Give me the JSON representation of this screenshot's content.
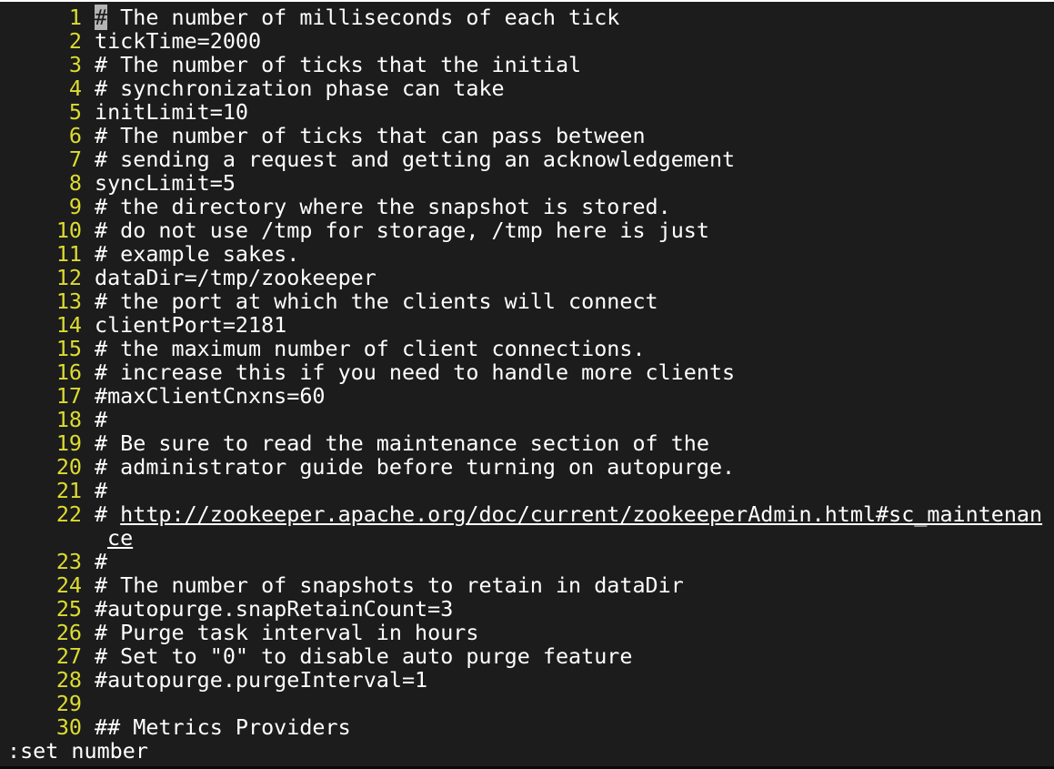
{
  "editor": {
    "lines": [
      {
        "num": "1",
        "text": " The number of milliseconds of each tick"
      },
      {
        "num": "2",
        "text": "tickTime=2000"
      },
      {
        "num": "3",
        "text": "# The number of ticks that the initial"
      },
      {
        "num": "4",
        "text": "# synchronization phase can take"
      },
      {
        "num": "5",
        "text": "initLimit=10"
      },
      {
        "num": "6",
        "text": "# The number of ticks that can pass between"
      },
      {
        "num": "7",
        "text": "# sending a request and getting an acknowledgement"
      },
      {
        "num": "8",
        "text": "syncLimit=5"
      },
      {
        "num": "9",
        "text": "# the directory where the snapshot is stored."
      },
      {
        "num": "10",
        "text": "# do not use /tmp for storage, /tmp here is just"
      },
      {
        "num": "11",
        "text": "# example sakes."
      },
      {
        "num": "12",
        "text": "dataDir=/tmp/zookeeper"
      },
      {
        "num": "13",
        "text": "# the port at which the clients will connect"
      },
      {
        "num": "14",
        "text": "clientPort=2181"
      },
      {
        "num": "15",
        "text": "# the maximum number of client connections."
      },
      {
        "num": "16",
        "text": "# increase this if you need to handle more clients"
      },
      {
        "num": "17",
        "text": "#maxClientCnxns=60"
      },
      {
        "num": "18",
        "text": "#"
      },
      {
        "num": "19",
        "text": "# Be sure to read the maintenance section of the"
      },
      {
        "num": "20",
        "text": "# administrator guide before turning on autopurge."
      },
      {
        "num": "21",
        "text": "#"
      },
      {
        "num": "22",
        "text": "# ",
        "url": "http://zookeeper.apache.org/doc/current/zookeeperAdmin.html#sc_maintenan",
        "url_cont": "ce"
      },
      {
        "num": "23",
        "text": "#"
      },
      {
        "num": "24",
        "text": "# The number of snapshots to retain in dataDir"
      },
      {
        "num": "25",
        "text": "#autopurge.snapRetainCount=3"
      },
      {
        "num": "26",
        "text": "# Purge task interval in hours"
      },
      {
        "num": "27",
        "text": "# Set to \"0\" to disable auto purge feature"
      },
      {
        "num": "28",
        "text": "#autopurge.purgeInterval=1"
      },
      {
        "num": "29",
        "text": ""
      },
      {
        "num": "30",
        "text": "## Metrics Providers"
      }
    ],
    "cursor_char": "#"
  },
  "command_line": {
    "text": ":set number"
  },
  "colors": {
    "background": "#1c1c1c",
    "line_number": "#dcdc32",
    "text": "#ffffff",
    "cursor": "#b4b4b4"
  }
}
